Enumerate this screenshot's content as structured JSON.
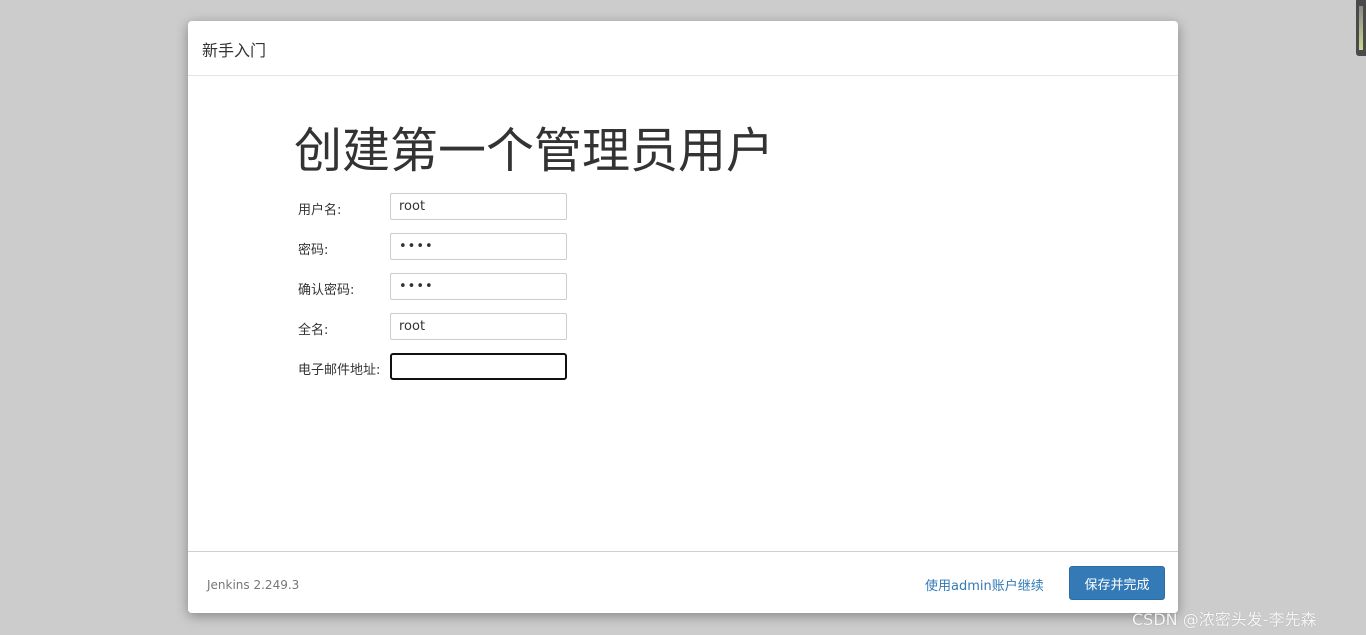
{
  "dialog": {
    "title": "新手入门"
  },
  "main": {
    "heading": "创建第一个管理员用户",
    "fields": {
      "username": {
        "label": "用户名:",
        "value": "root"
      },
      "password": {
        "label": "密码:",
        "value": "••••"
      },
      "confirm_password": {
        "label": "确认密码:",
        "value": "••••"
      },
      "full_name": {
        "label": "全名:",
        "value": "root"
      },
      "email": {
        "label": "电子邮件地址:",
        "value": ""
      }
    }
  },
  "footer": {
    "version": "Jenkins 2.249.3",
    "continue_link": "使用admin账户继续",
    "save_button": "保存并完成"
  },
  "watermark": "CSDN @浓密头发-李先森",
  "colors": {
    "primary": "#337ab7",
    "background": "#cccccc"
  }
}
